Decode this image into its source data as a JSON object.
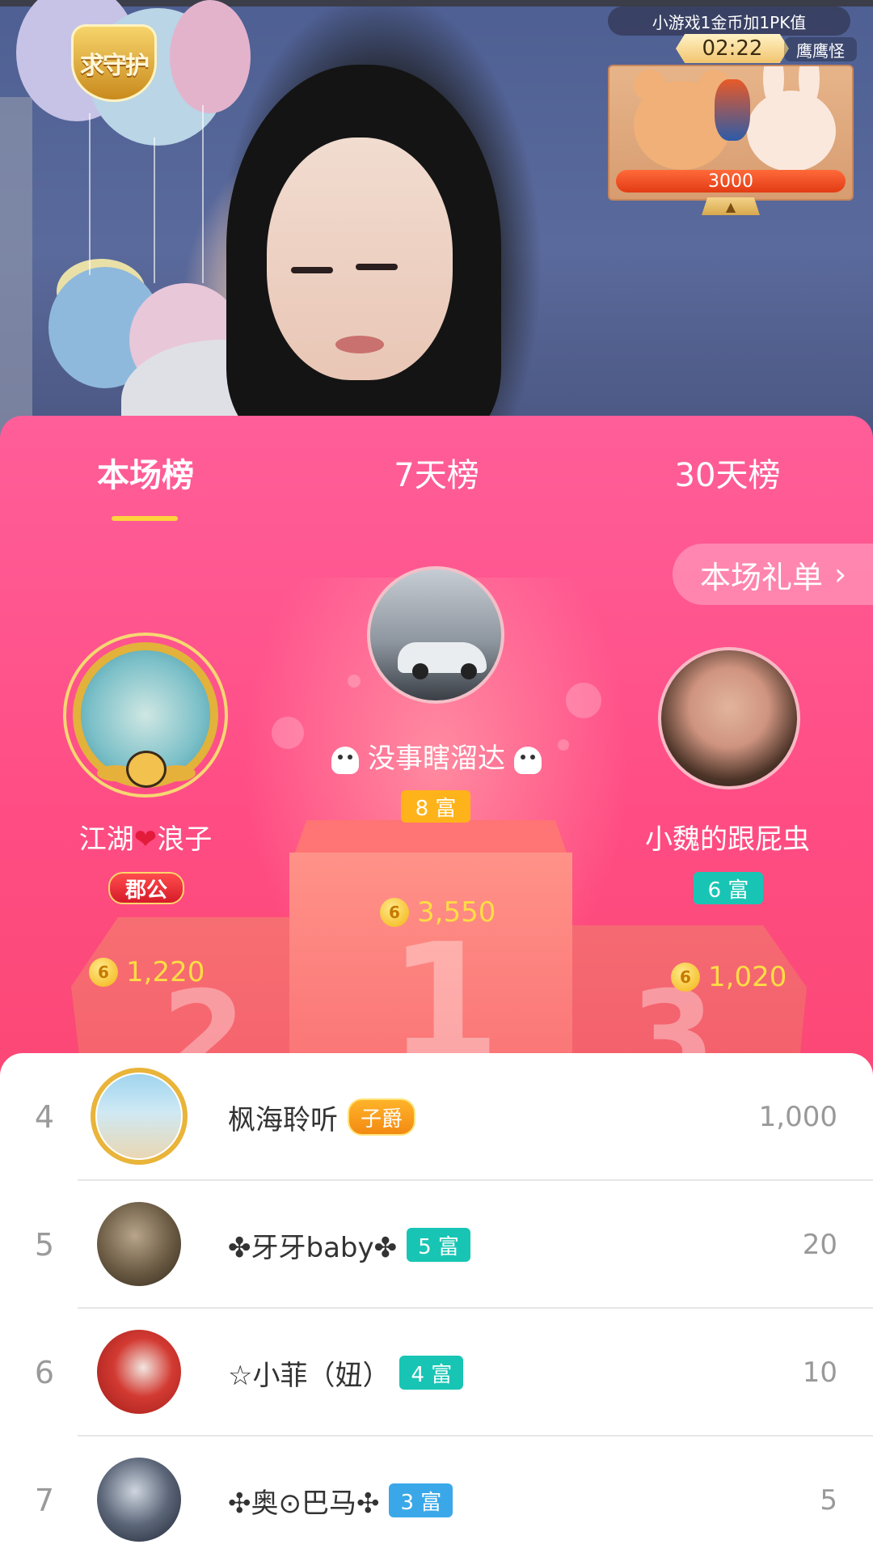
{
  "video": {
    "guard_badge": "求守护",
    "pk": {
      "banner": "小游戏1金币加1PK值",
      "timer": "02:22",
      "opponent": "鹰鹰怪",
      "score": "3000"
    }
  },
  "tabs": [
    {
      "label": "本场榜",
      "active": true
    },
    {
      "label": "7天榜",
      "active": false
    },
    {
      "label": "30天榜",
      "active": false
    }
  ],
  "gift_list": {
    "label": "本场礼单",
    "chevron": "›"
  },
  "podium": {
    "first": {
      "rank": "1",
      "name": "没事瞎溜达",
      "badge": "8 富",
      "coins": "3,550"
    },
    "second": {
      "rank": "2",
      "name_left": "江湖",
      "name_right": "浪子",
      "badge": "郡公",
      "coins": "1,220"
    },
    "third": {
      "rank": "3",
      "name": "小魏的跟屁虫",
      "badge": "6 富",
      "coins": "1,020"
    }
  },
  "list": [
    {
      "rank": "4",
      "name": "枫海聆听",
      "badge": "子爵",
      "score": "1,000"
    },
    {
      "rank": "5",
      "name": "✤牙牙baby✤",
      "badge": "5 富",
      "score": "20"
    },
    {
      "rank": "6",
      "name": "☆小菲（妞）",
      "badge": "4 富",
      "score": "10"
    },
    {
      "rank": "7",
      "name": "✣奥⊙巴马✣",
      "badge": "3 富",
      "score": "5"
    }
  ],
  "colors": {
    "panel_pink": "#ff4d84",
    "tab_underline": "#ffd23c",
    "coin_text": "#ffdd44",
    "rich_teal": "#18c5b4",
    "rich_blue": "#3aa8e8",
    "rich_orange": "#ffb31a"
  }
}
